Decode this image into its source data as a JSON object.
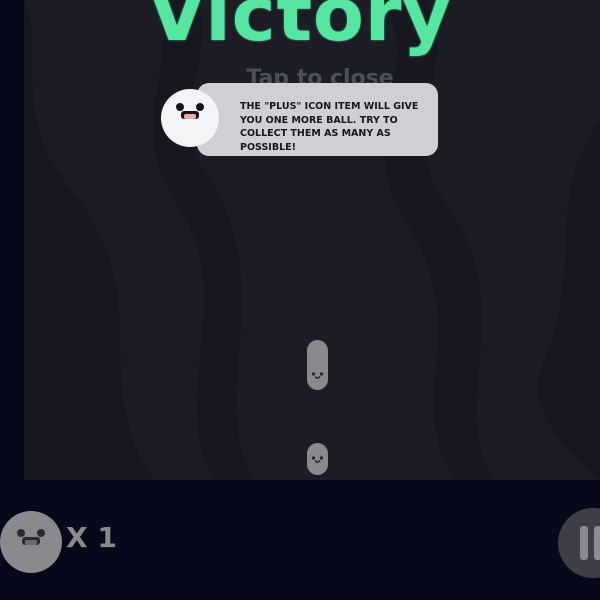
{
  "screen": {
    "title": "Victory",
    "tap_hint": "Tap to close"
  },
  "tip": {
    "text": "THE \"PLUS\" ICON ITEM WILL GIVE YOU ONE MORE BALL. TRY TO COLLECT THEM AS MANY AS POSSIBLE!",
    "icon": "smiling-ball-mascot-icon"
  },
  "hud": {
    "ball_count": "X 1",
    "ball_icon": "ball-face-icon",
    "pause_icon": "pause-icon"
  },
  "colors": {
    "title": "#57e6a1",
    "playfield": "#1b1c24",
    "background": "#07091a",
    "bubble": "#d0d0d4",
    "ball": "#8a8a8e"
  }
}
